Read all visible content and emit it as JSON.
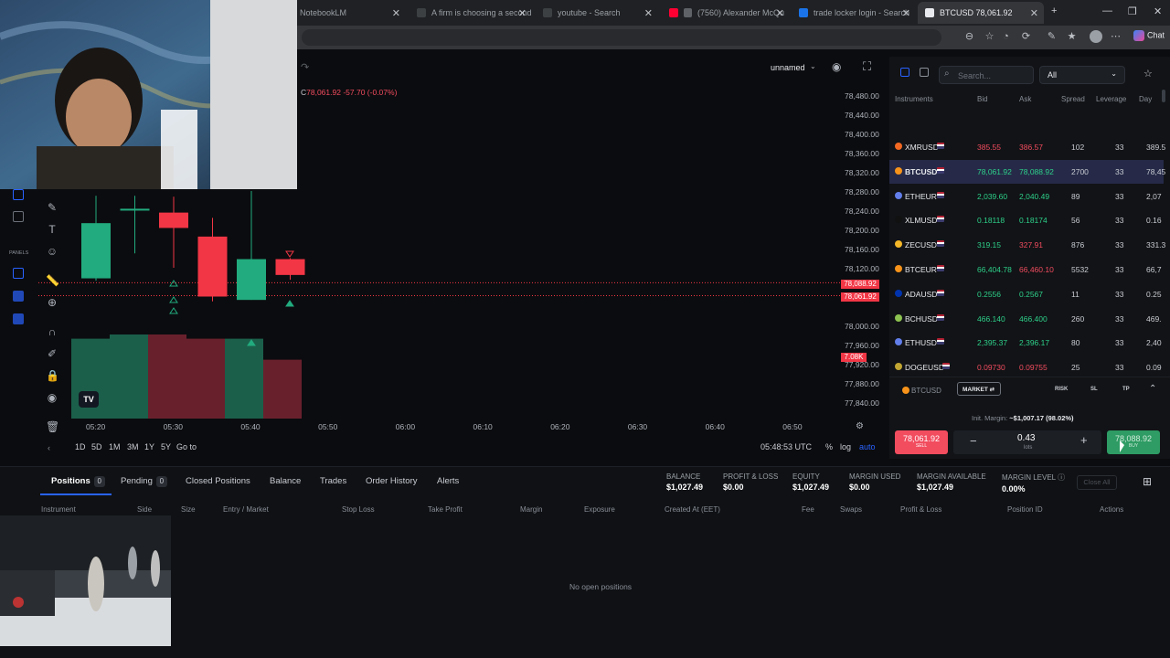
{
  "browser": {
    "tabs": [
      {
        "title": "NotebookLM"
      },
      {
        "title": "A firm is choosing a second"
      },
      {
        "title": "youtube - Search"
      },
      {
        "title": "(7560) Alexander McQu"
      },
      {
        "title": "trade locker login - Search"
      },
      {
        "title": "BTCUSD 78,061.92"
      }
    ],
    "chat_label": "Chat"
  },
  "chart": {
    "layout_name": "unnamed",
    "ohlc_close_label": "C",
    "ohlc_close": "78,061.92",
    "ohlc_change": "-57.70 (-0.07%)",
    "price_ticks": [
      "78,480.00",
      "78,440.00",
      "78,400.00",
      "78,360.00",
      "78,320.00",
      "78,280.00",
      "78,240.00",
      "78,200.00",
      "78,160.00",
      "78,120.00",
      "78,000.00",
      "77,960.00",
      "77,920.00",
      "77,880.00",
      "77,840.00"
    ],
    "ask_tag": "78,088.92",
    "bid_tag": "78,061.92",
    "volume_tag": "7.08K",
    "time_ticks": [
      "05:20",
      "05:30",
      "05:40",
      "05:50",
      "06:00",
      "06:10",
      "06:20",
      "06:30",
      "06:40",
      "06:50"
    ],
    "timeframes": [
      "1D",
      "5D",
      "1M",
      "3M",
      "1Y",
      "5Y"
    ],
    "goto": "Go to",
    "clock": "05:48:53 UTC",
    "scale_opts": [
      "%",
      "log",
      "auto"
    ],
    "panels_label": "PANELS",
    "logo": "TV",
    "candles": [
      {
        "o": 78098,
        "c": 78213,
        "h": 78270,
        "l": 78093,
        "dir": "up"
      },
      {
        "o": 78240,
        "c": 78243,
        "h": 78270,
        "l": 78150,
        "dir": "up"
      },
      {
        "o": 78235,
        "c": 78203,
        "h": 78268,
        "l": 78120,
        "dir": "down"
      },
      {
        "o": 78185,
        "c": 78060,
        "h": 78224,
        "l": 78050,
        "dir": "down"
      },
      {
        "o": 78053,
        "c": 78138,
        "h": 78280,
        "l": 78053,
        "dir": "up"
      },
      {
        "o": 78138,
        "c": 78105,
        "h": 78140,
        "l": 78095,
        "dir": "down"
      }
    ],
    "volumes": [
      0.95,
      1.0,
      1.0,
      0.95,
      0.95,
      0.7
    ]
  },
  "instruments": {
    "search_placeholder": "Search...",
    "filter": "All",
    "columns": [
      "Instruments",
      "Bid",
      "Ask",
      "Spread",
      "Leverage",
      "Day"
    ],
    "rows": [
      {
        "symbol": "XMRUSD",
        "bid": "385.55",
        "ask": "386.57",
        "spread": "102",
        "leverage": "33",
        "day": "389.5",
        "bid_color": "red",
        "ask_color": "red",
        "coin": "#f26822"
      },
      {
        "symbol": "BTCUSD",
        "bid": "78,061.92",
        "ask": "78,088.92",
        "spread": "2700",
        "leverage": "33",
        "day": "78,45",
        "bid_color": "green",
        "ask_color": "green",
        "coin": "#f7931a",
        "selected": true
      },
      {
        "symbol": "ETHEUR",
        "bid": "2,039.60",
        "ask": "2,040.49",
        "spread": "89",
        "leverage": "33",
        "day": "2,07",
        "bid_color": "green",
        "ask_color": "green",
        "coin": "#627eea"
      },
      {
        "symbol": "XLMUSD",
        "bid": "0.18118",
        "ask": "0.18174",
        "spread": "56",
        "leverage": "33",
        "day": "0.16",
        "bid_color": "green",
        "ask_color": "green",
        "coin": "#111111"
      },
      {
        "symbol": "ZECUSD",
        "bid": "319.15",
        "ask": "327.91",
        "spread": "876",
        "leverage": "33",
        "day": "331.3",
        "bid_color": "green",
        "ask_color": "red",
        "coin": "#f4b728"
      },
      {
        "symbol": "BTCEUR",
        "bid": "66,404.78",
        "ask": "66,460.10",
        "spread": "5532",
        "leverage": "33",
        "day": "66,7",
        "bid_color": "green",
        "ask_color": "red",
        "coin": "#f7931a"
      },
      {
        "symbol": "ADAUSD",
        "bid": "0.2556",
        "ask": "0.2567",
        "spread": "11",
        "leverage": "33",
        "day": "0.25",
        "bid_color": "green",
        "ask_color": "green",
        "coin": "#0033ad"
      },
      {
        "symbol": "BCHUSD",
        "bid": "466.140",
        "ask": "466.400",
        "spread": "260",
        "leverage": "33",
        "day": "469.",
        "bid_color": "green",
        "ask_color": "green",
        "coin": "#8dc351"
      },
      {
        "symbol": "ETHUSD",
        "bid": "2,395.37",
        "ask": "2,396.17",
        "spread": "80",
        "leverage": "33",
        "day": "2,40",
        "bid_color": "green",
        "ask_color": "green",
        "coin": "#627eea"
      },
      {
        "symbol": "DOGEUSD",
        "bid": "0.09730",
        "ask": "0.09755",
        "spread": "25",
        "leverage": "33",
        "day": "0.09",
        "bid_color": "red",
        "ask_color": "red",
        "coin": "#c2a633"
      }
    ]
  },
  "order": {
    "symbol": "BTCUSD",
    "type": "MARKET",
    "tabs": [
      "RISK",
      "SL",
      "TP"
    ],
    "margin_label": "Init. Margin:",
    "margin_value": "~$1,007.17 (98.02%)",
    "sell_price": "78,061.92",
    "sell_label": "SELL",
    "buy_price": "78,088.92",
    "buy_label": "BUY",
    "lots": "0.43",
    "lots_label": "lots"
  },
  "bottom": {
    "tabs": [
      {
        "label": "Positions",
        "count": "0"
      },
      {
        "label": "Pending",
        "count": "0"
      },
      {
        "label": "Closed Positions"
      },
      {
        "label": "Balance"
      },
      {
        "label": "Trades"
      },
      {
        "label": "Order History"
      },
      {
        "label": "Alerts"
      }
    ],
    "stats": [
      {
        "label": "BALANCE",
        "value": "$1,027.49"
      },
      {
        "label": "PROFIT & LOSS",
        "value": "$0.00"
      },
      {
        "label": "EQUITY",
        "value": "$1,027.49"
      },
      {
        "label": "MARGIN USED",
        "value": "$0.00"
      },
      {
        "label": "MARGIN AVAILABLE",
        "value": "$1,027.49"
      },
      {
        "label": "MARGIN LEVEL",
        "value": "0.00%"
      }
    ],
    "close_all": "Close All",
    "columns": [
      "Instrument",
      "Side",
      "Size",
      "Entry / Market",
      "Stop Loss",
      "Take Profit",
      "Margin",
      "Exposure",
      "Created At (EET)",
      "Fee",
      "Swaps",
      "Profit & Loss",
      "Position ID",
      "Actions"
    ],
    "empty": "No open positions"
  },
  "colors": {
    "bull": "#22ab7e",
    "bear": "#f23645",
    "accent": "#2962ff"
  }
}
